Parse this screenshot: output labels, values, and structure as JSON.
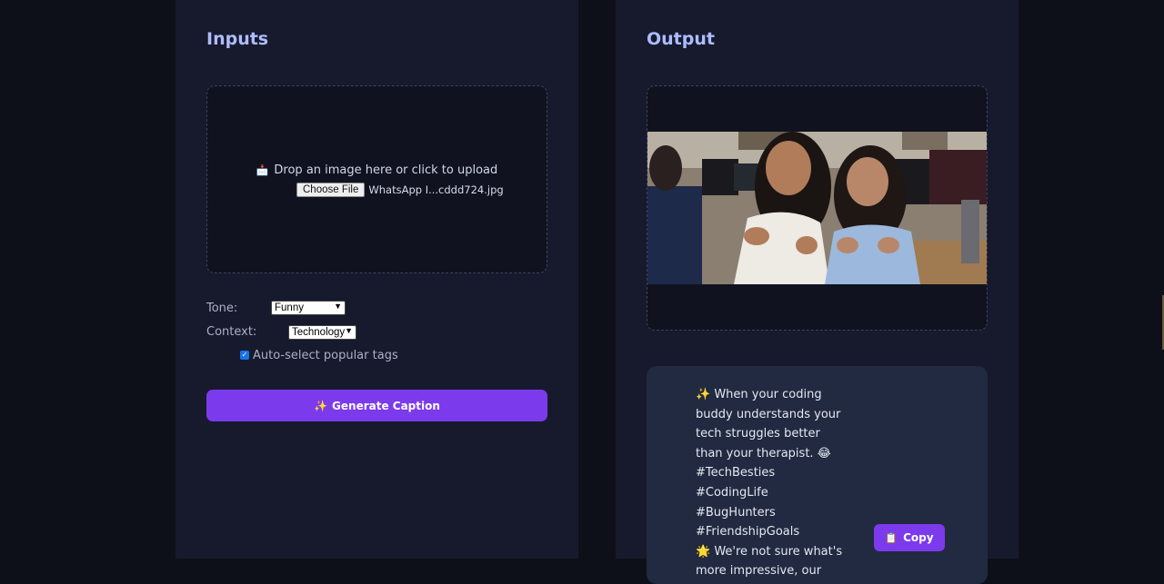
{
  "inputs": {
    "title": "Inputs",
    "drop_icon": "inbox-icon",
    "drop_text": "Drop an image here or click to upload",
    "choose_file_label": "Choose File",
    "file_name": "WhatsApp I...cddd724.jpg",
    "tone_label": "Tone:",
    "tone_value": "Funny",
    "context_label": "Context:",
    "context_value": "Technology",
    "auto_tags_label": "Auto-select popular tags",
    "auto_tags_checked": true,
    "generate_label": "Generate Caption",
    "generate_icon": "✨"
  },
  "output": {
    "title": "Output",
    "caption": "When your coding buddy understands your tech struggles better than your therapist. 😂\n#TechBesties #CodingLife #BugHunters #FriendshipGoals",
    "caption_line1_icon": "✨",
    "caption_line2_icon": "🌟",
    "caption_line2": "We're not sure what's more impressive, our",
    "copy_label": "Copy",
    "copy_icon": "clipboard-icon"
  },
  "colors": {
    "accent": "#7c3aed",
    "panel": "#161a2c",
    "title": "#aebcff",
    "card": "#212a40"
  }
}
